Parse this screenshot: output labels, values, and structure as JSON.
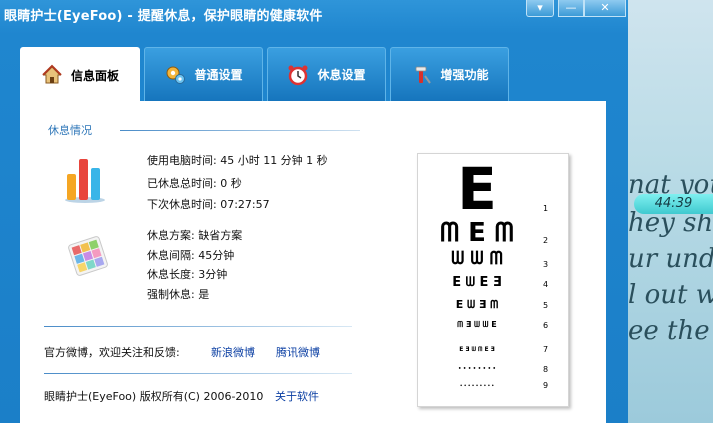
{
  "window": {
    "title": "眼睛护士(EyeFoo) - 提醒休息，保护眼睛的健康软件",
    "buttons": {
      "menu": "▾",
      "minimize": "—",
      "close": "✕"
    }
  },
  "tabs": [
    {
      "label": "信息面板",
      "icon": "house-icon",
      "active": true
    },
    {
      "label": "普通设置",
      "icon": "gears-icon",
      "active": false
    },
    {
      "label": "休息设置",
      "icon": "alarm-clock-icon",
      "active": false
    },
    {
      "label": "增强功能",
      "icon": "tools-icon",
      "active": false
    }
  ],
  "info": {
    "section_title": "休息情况",
    "stats": {
      "usage": "使用电脑时间:  45 小时 11 分钟 1 秒",
      "rest_total": "已休息总时间:  0 秒",
      "next_rest": "下次休息时间:  07:27:57"
    },
    "plan": {
      "scheme": "休息方案: 缺省方案",
      "interval": "休息间隔: 45分钟",
      "length": "休息长度: 3分钟",
      "forced": "强制休息: 是"
    },
    "weibo_text": "官方微博，欢迎关注和反馈:",
    "weibo_sina": "新浪微博",
    "weibo_tencent": "腾讯微博",
    "copyright": "眼睛护士(EyeFoo) 版权所有(C) 2006-2010",
    "about": "关于软件"
  },
  "eye_chart": {
    "rows": [
      {
        "letters": "E",
        "size": 58,
        "num": "1"
      },
      {
        "letters": "ᗰ E ᗰ",
        "size": 26,
        "num": "2"
      },
      {
        "letters": "ᗯ ᗯ ᗰ",
        "size": 18,
        "num": "3"
      },
      {
        "letters": "E ᗯ E Ǝ",
        "size": 13,
        "num": "4"
      },
      {
        "letters": "E ᗯ Ǝ ᗰ",
        "size": 11,
        "num": "5"
      },
      {
        "letters": "ᗰ Ǝ ᗯ ᗯ E",
        "size": 8,
        "num": "6"
      },
      {
        "letters": "E Ǝ ᗯ ᗰ E Ǝ",
        "size": 6,
        "num": "7"
      },
      {
        "letters": "• • • • • • • •",
        "size": 4,
        "num": "8"
      },
      {
        "letters": "• • • • • • • • •",
        "size": 3,
        "num": "9"
      }
    ]
  },
  "background": {
    "clock": "44:39",
    "lines": [
      "nat you",
      "hey show",
      "ur unde",
      "l out wh",
      "ee the w"
    ]
  }
}
